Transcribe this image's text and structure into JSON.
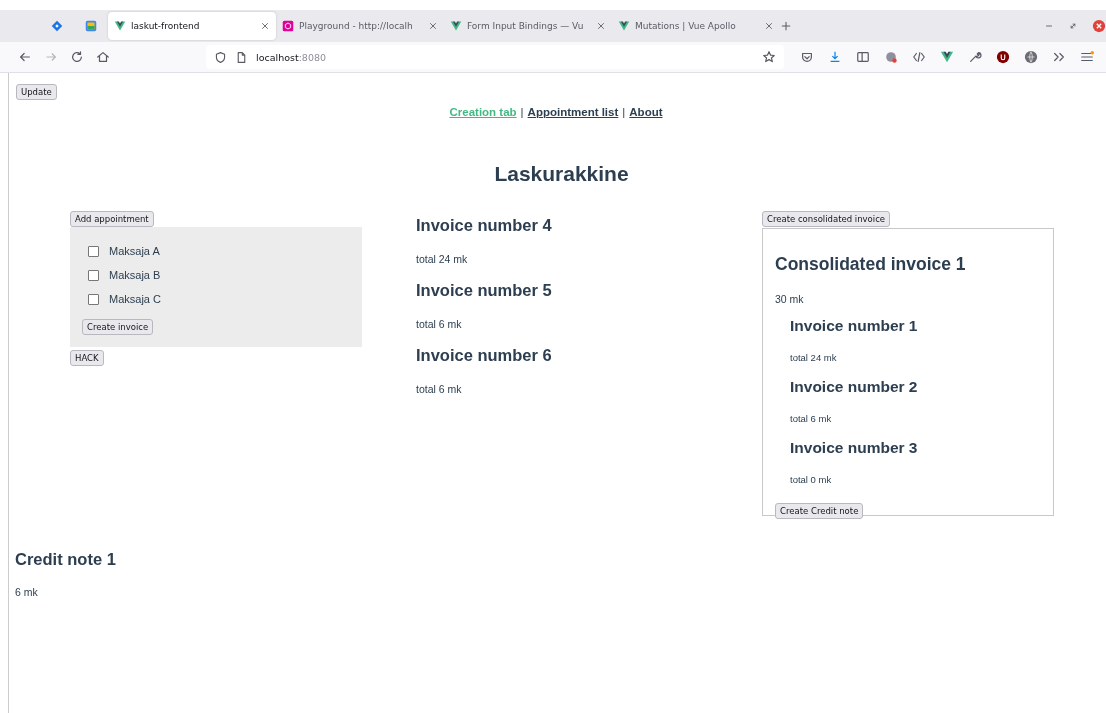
{
  "browser": {
    "tabs": [
      {
        "title": "laskut-frontend",
        "kind": "vue",
        "selected": true
      },
      {
        "title": "Playground - http://localh",
        "kind": "graphql",
        "selected": false
      },
      {
        "title": "Form Input Bindings — Vu",
        "kind": "vue",
        "selected": false
      },
      {
        "title": "Mutations | Vue Apollo",
        "kind": "vue",
        "selected": false
      }
    ],
    "url": {
      "host": "localhost",
      "port": ":8080"
    }
  },
  "page": {
    "update_button": "Update",
    "nav": [
      {
        "kind": "link",
        "label": "Creation tab",
        "selected": true
      },
      {
        "kind": "separator",
        "label": "|"
      },
      {
        "kind": "link",
        "label": "Appointment list",
        "selected": false
      },
      {
        "kind": "separator",
        "label": "|"
      },
      {
        "kind": "link",
        "label": "About",
        "selected": false
      }
    ],
    "title": "Laskurakkine",
    "add_appointment_button": "Add appointment",
    "payers": [
      {
        "label": "Maksaja A",
        "checked": false
      },
      {
        "label": "Maksaja B",
        "checked": false
      },
      {
        "label": "Maksaja C",
        "checked": false
      }
    ],
    "create_invoice_button": "Create invoice",
    "hack_button": "HACK",
    "invoices": [
      {
        "title": "Invoice number 4",
        "total": "total 24 mk"
      },
      {
        "title": "Invoice number 5",
        "total": "total 6 mk"
      },
      {
        "title": "Invoice number 6",
        "total": "total 6 mk"
      }
    ],
    "create_consolidated_button": "Create consolidated invoice",
    "consolidated": {
      "title": "Consolidated invoice 1",
      "total": "30 mk",
      "invoices": [
        {
          "title": "Invoice number 1",
          "total": "total 24 mk"
        },
        {
          "title": "Invoice number 2",
          "total": "total 6 mk"
        },
        {
          "title": "Invoice number 3",
          "total": "total 0 mk"
        }
      ],
      "credit_button": "Create Credit note"
    },
    "credit_notes": [
      {
        "title": "Credit note 1",
        "total": "6 mk"
      }
    ]
  }
}
